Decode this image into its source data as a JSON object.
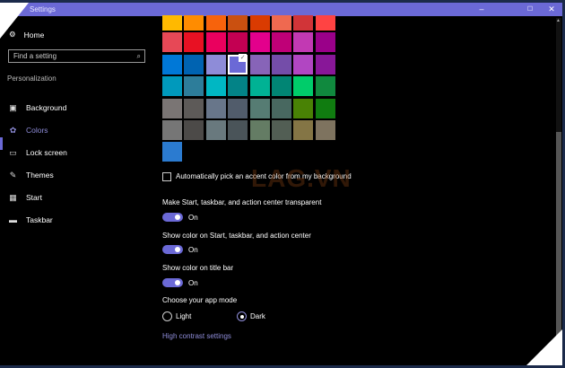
{
  "window": {
    "title": "Settings",
    "controls": {
      "minimize": "–",
      "maximize": "☐",
      "close": "✕"
    },
    "accent": "#6B69D6"
  },
  "nav": {
    "home": "Home",
    "home_icon": "gear-icon",
    "search_placeholder": "Find a setting",
    "search_icon": "search-icon",
    "section": "Personalization",
    "items": [
      {
        "label": "Background",
        "icon": "image-icon",
        "glyph": "▣"
      },
      {
        "label": "Colors",
        "icon": "palette-icon",
        "glyph": "✿",
        "active": true
      },
      {
        "label": "Lock screen",
        "icon": "lock-screen-icon",
        "glyph": "▭"
      },
      {
        "label": "Themes",
        "icon": "themes-icon",
        "glyph": "✎"
      },
      {
        "label": "Start",
        "icon": "start-icon",
        "glyph": "▦"
      },
      {
        "label": "Taskbar",
        "icon": "taskbar-icon",
        "glyph": "▬"
      }
    ]
  },
  "colors": {
    "swatches": [
      [
        "#FFB900",
        "#FF8C00",
        "#F7630C",
        "#CA5010",
        "#DA3B01",
        "#EF6950",
        "#D13438",
        "#FF4343"
      ],
      [
        "#E74856",
        "#E81123",
        "#EA005E",
        "#C30052",
        "#E3008C",
        "#BF0077",
        "#C239B3",
        "#9A0089"
      ],
      [
        "#0078D7",
        "#0063B1",
        "#8E8CD8",
        "#6B69D6",
        "#8764B8",
        "#744DA9",
        "#B146C2",
        "#881798"
      ],
      [
        "#0099BC",
        "#2D7D9A",
        "#00B7C3",
        "#038387",
        "#00B294",
        "#018574",
        "#00CC6A",
        "#10893E"
      ],
      [
        "#7A7574",
        "#5D5A58",
        "#68768A",
        "#515C6B",
        "#567C73",
        "#486860",
        "#498205",
        "#107C10"
      ],
      [
        "#767676",
        "#4C4A48",
        "#69797E",
        "#4A5459",
        "#647C64",
        "#525E54",
        "#847545",
        "#7E735F"
      ],
      [
        "#2B7BD0"
      ]
    ],
    "selected": "#6B69D6",
    "auto_pick": {
      "label": "Automatically pick an accent color from my background",
      "checked": false
    },
    "transparent": {
      "label": "Make Start, taskbar, and action center transparent",
      "state": "On"
    },
    "show_start": {
      "label": "Show color on Start, taskbar, and action center",
      "state": "On"
    },
    "show_title": {
      "label": "Show color on title bar",
      "state": "On"
    },
    "app_mode": {
      "label": "Choose your app mode",
      "options": [
        "Light",
        "Dark"
      ],
      "selected": "Dark"
    },
    "high_contrast": "High contrast settings"
  },
  "watermark": "LAG.VN"
}
